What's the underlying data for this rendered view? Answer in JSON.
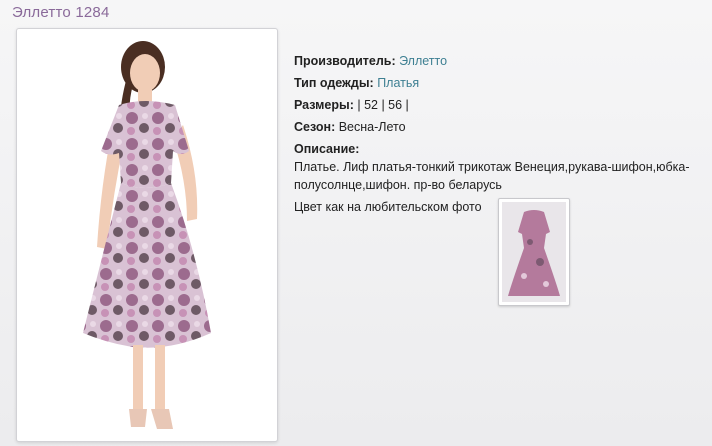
{
  "product": {
    "title": "Эллетто 1284",
    "manufacturer_label": "Производитель:",
    "manufacturer_value": "Эллетто",
    "clothing_type_label": "Тип одежды:",
    "clothing_type_value": "Платья",
    "sizes_label": "Размеры:",
    "sizes_value": "| 52 | 56 |",
    "season_label": "Сезон:",
    "season_value": "Весна-Лето",
    "description_label": "Описание:",
    "description_text": "Платье. Лиф платья-тонкий трикотаж Венеция,рукава-шифон,юбка-полусолнце,шифон. пр-во беларусь",
    "photo_note": "Цвет как на любительском фото"
  },
  "colors": {
    "title": "#8a6a9a",
    "link": "#3d7f92",
    "dress_main": "#b58aa8",
    "dress_dark": "#6e5a66"
  }
}
